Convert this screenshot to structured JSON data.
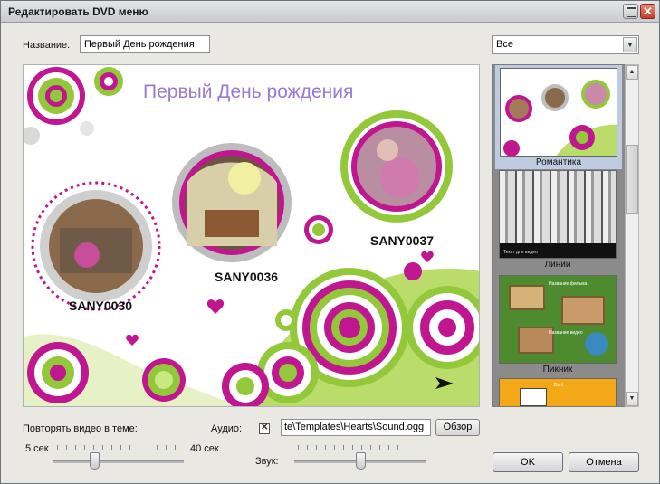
{
  "window": {
    "title": "Редактировать DVD меню"
  },
  "name_field": {
    "label": "Название:",
    "value": "Первый День рождения"
  },
  "filter": {
    "selected": "Все"
  },
  "preview": {
    "menu_title": "Первый День рождения",
    "clips": [
      {
        "label": "SANY0030"
      },
      {
        "label": "SANY0036"
      },
      {
        "label": "SANY0037"
      }
    ]
  },
  "templates": [
    {
      "name": "Романтика",
      "selected": true
    },
    {
      "name": "Линии",
      "caption": "Текст для видео"
    },
    {
      "name": "Пикник",
      "captions": [
        "Название фильма",
        "Название видео"
      ]
    },
    {
      "name": "",
      "caption": "Do it"
    }
  ],
  "repeat_video": {
    "label": "Повторять видео в теме:",
    "min_label": "5 сек",
    "max_label": "40 сек",
    "value_fraction": 0.31
  },
  "audio": {
    "label": "Аудио:",
    "enabled": true,
    "path": "te\\Templates\\Hearts\\Sound.ogg",
    "browse_label": "Обзор"
  },
  "volume": {
    "label": "Звук:",
    "value_fraction": 0.5
  },
  "buttons": {
    "ok": "OK",
    "cancel": "Отмена"
  },
  "colors": {
    "magenta": "#c0168f",
    "lime": "#93c83b",
    "grey": "#c8c8c8"
  }
}
